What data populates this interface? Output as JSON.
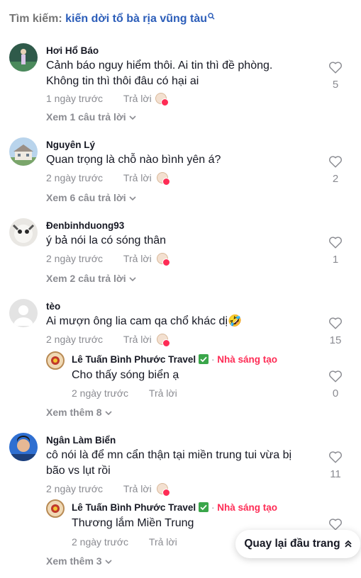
{
  "search": {
    "label": "Tìm kiếm:",
    "term": "kiến dời tổ bà rịa vũng tàu"
  },
  "comments": [
    {
      "username": "Hơi Hổ Báo",
      "text": "Cảnh báo nguy hiểm thôi. Ai tin thì đề phòng. Không tin thì thôi đâu có hại ai",
      "time": "1 ngày trước",
      "reply_label": "Trả lời",
      "likes": "5",
      "view_replies": "Xem 1 câu trả lời"
    },
    {
      "username": "Nguyên Lý",
      "text": "Quan trọng là chỗ nào bình yên á?",
      "time": "2 ngày trước",
      "reply_label": "Trả lời",
      "likes": "2",
      "view_replies": "Xem 6 câu trả lời"
    },
    {
      "username": "Đenbinhduong93",
      "text": "ý bả nói la có sóng thân",
      "time": "2 ngày trước",
      "reply_label": "Trả lời",
      "likes": "1",
      "view_replies": "Xem 2 câu trả lời"
    },
    {
      "username": "tèo",
      "text": "Ai mượn ông lia cam qa chổ khác dị🤣",
      "time": "2 ngày trước",
      "reply_label": "Trả lời",
      "likes": "15",
      "reply": {
        "username": "Lê Tuấn Bình Phước Travel",
        "separator": "·",
        "creator_label": "Nhà sáng tạo",
        "text": "Cho thấy sóng biển ạ",
        "time": "2 ngày trước",
        "reply_label": "Trả lời",
        "likes": "0"
      },
      "view_more": "Xem thêm 8"
    },
    {
      "username": "Ngân Làm Biển",
      "text": "cô nói là để mn cẩn thận tại miền trung tui vừa bị bão vs lụt rồi",
      "time": "2 ngày trước",
      "reply_label": "Trả lời",
      "likes": "11",
      "reply": {
        "username": "Lê Tuấn Bình Phước Travel",
        "separator": "·",
        "creator_label": "Nhà sáng tạo",
        "text": "Thương lắm Miền Trung",
        "time": "2 ngày trước",
        "reply_label": "Trả lời"
      },
      "view_more": "Xem thêm 3"
    }
  ],
  "back_to_top": "Quay lại đầu trang",
  "colors": {
    "accent": "#fe2c55",
    "link": "#2b5db9",
    "muted": "#8a8b91",
    "verified": "#3aa64a"
  }
}
